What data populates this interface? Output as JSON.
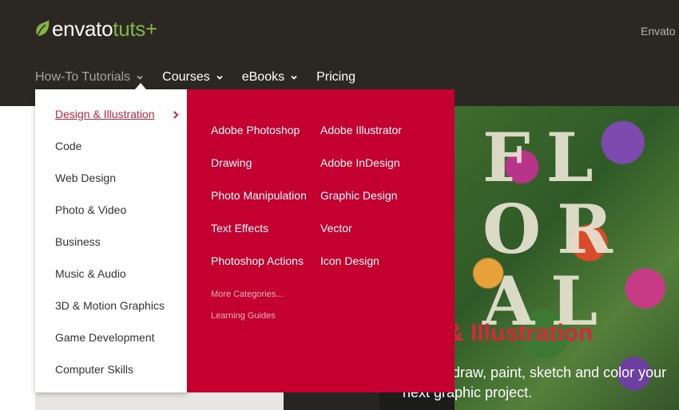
{
  "header": {
    "logo_brand": "envato",
    "logo_product": "tuts+",
    "top_right_text": "Envato M"
  },
  "nav": {
    "items": [
      {
        "label": "How-To Tutorials",
        "has_dropdown": true,
        "active": true
      },
      {
        "label": "Courses",
        "has_dropdown": true
      },
      {
        "label": "eBooks",
        "has_dropdown": true
      },
      {
        "label": "Pricing",
        "has_dropdown": false
      }
    ]
  },
  "menu": {
    "categories": [
      {
        "label": "Design & Illustration",
        "active": true
      },
      {
        "label": "Code"
      },
      {
        "label": "Web Design"
      },
      {
        "label": "Photo & Video"
      },
      {
        "label": "Business"
      },
      {
        "label": "Music & Audio"
      },
      {
        "label": "3D & Motion Graphics"
      },
      {
        "label": "Game Development"
      },
      {
        "label": "Computer Skills"
      }
    ],
    "subcategories_col1": [
      "Adobe Photoshop",
      "Drawing",
      "Photo Manipulation",
      "Text Effects",
      "Photoshop Actions"
    ],
    "subcategories_col2": [
      "Adobe Illustrator",
      "Adobe InDesign",
      "Graphic Design",
      "Vector",
      "Icon Design"
    ],
    "more_categories": "More Categories...",
    "learning_guides": "Learning Guides"
  },
  "hero": {
    "title_visible": "gn & Illustration",
    "subtitle_line1": "draw, paint, sketch and color your",
    "subtitle_line2": "next graphic project.",
    "letters": "FL OR AL"
  },
  "colors": {
    "header_bg": "#2b2823",
    "brand_green": "#82b541",
    "menu_red": "#c3002f",
    "active_link": "#c0283a"
  }
}
